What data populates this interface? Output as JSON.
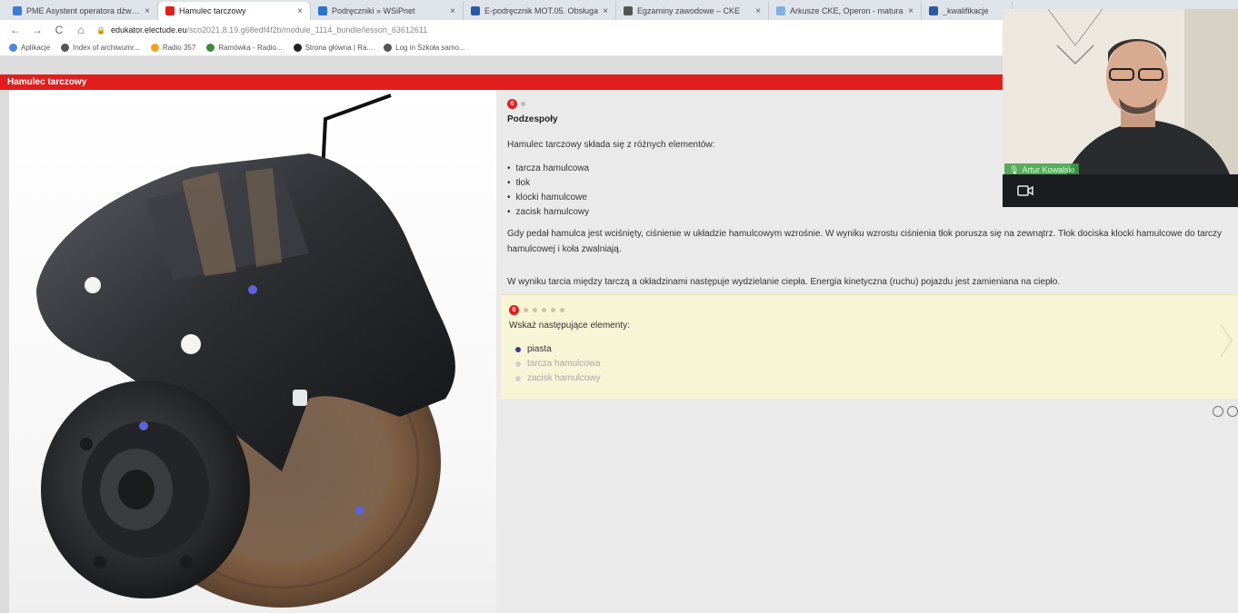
{
  "tabs": [
    {
      "title": "PME Asystent operatora dźwięk",
      "favicon_color": "#3c7bd8",
      "active": false
    },
    {
      "title": "Hamulec tarczowy",
      "favicon_color": "#e11e1e",
      "active": true
    },
    {
      "title": "Podręczniki » WSiPnet",
      "favicon_color": "#2a74c9",
      "active": false
    },
    {
      "title": "E-podręcznik MOT.05. Obsługa",
      "favicon_color": "#2b5aa8",
      "active": false
    },
    {
      "title": "Egzaminy zawodowe – CKE",
      "favicon_color": "#555555",
      "active": false
    },
    {
      "title": "Arkusze CKE, Operon - matura",
      "favicon_color": "#7fb0e0",
      "active": false
    },
    {
      "title": "_kwalifikacje",
      "favicon_color": "#2b5aa8",
      "active": false
    }
  ],
  "tab_close": "×",
  "nav": {
    "back": "←",
    "forward": "→",
    "reload": "C",
    "home": "⌂"
  },
  "url": {
    "lock": "🔒",
    "host": "edukator.electude.eu",
    "path": "/sco2021.8.19.g68edf4f2b/module_1114_bundle/lesson_63612611"
  },
  "bookmarks": [
    {
      "label": "Aplikacje",
      "color": "#4f86e0"
    },
    {
      "label": "Index of archiwumr...",
      "color": "#555555"
    },
    {
      "label": "Radio 357",
      "color": "#f0a020"
    },
    {
      "label": "Ramówka - Radio...",
      "color": "#3d8a3d"
    },
    {
      "label": "Strona główna | Ra...",
      "color": "#222222"
    },
    {
      "label": "Log in Szkoła samo...",
      "color": "#555555"
    }
  ],
  "page_title": "Hamulec tarczowy",
  "lesson": {
    "step_number": "0",
    "section_title": "Podzespoły",
    "intro": "Hamulec tarczowy składa się z różnych elementów:",
    "parts": [
      "tarcza hamulcowa",
      "tłok",
      "klocki hamulcowe",
      "zacisk hamulcowy"
    ],
    "paragraph1": "Gdy pedał hamulca jest wciśnięty, ciśnienie w układzie hamulcowym wzrośnie. W wyniku wzrostu ciśnienia tłok porusza się na zewnątrz. Tłok dociska klocki hamulcowe do tarczy hamulcowej i koła zwalniają.",
    "paragraph2": "W wyniku tarcia między tarczą a okładzinami następuje wydzielanie ciepła. Energia kinetyczna (ruchu) pojazdu jest zamieniana na ciepło."
  },
  "quiz": {
    "step_number": "0",
    "dots_count": 5,
    "question": "Wskaż następujące elementy:",
    "items": [
      {
        "label": "piasta",
        "state": "active"
      },
      {
        "label": "tarcza hamulcowa",
        "state": "pending"
      },
      {
        "label": "zacisk hamulcowy",
        "state": "pending"
      }
    ]
  },
  "webcam": {
    "participant_name": "Artur Kowalski",
    "mic_icon": "🎙"
  },
  "colors": {
    "brand_red": "#e11e1e",
    "quiz_bg": "#f8f4d6",
    "marker_blue": "#5b63d6"
  }
}
